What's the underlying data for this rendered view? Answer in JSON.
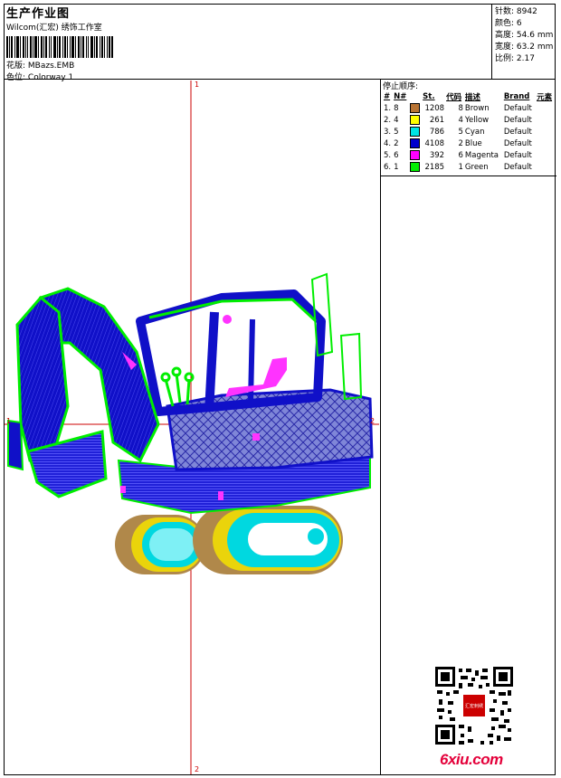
{
  "header": {
    "title": "生产作业图",
    "studio": "Wilcom(汇宏) 绣饰工作室",
    "design_label": "花版:",
    "design_value": "MBazs.EMB",
    "colorway_label": "色位:",
    "colorway_value": "Colorway 1"
  },
  "stats": [
    {
      "label": "针数:",
      "value": "8942"
    },
    {
      "label": "颜色:",
      "value": "6"
    },
    {
      "label": "高度:",
      "value": "54.6 mm"
    },
    {
      "label": "宽度:",
      "value": "63.2 mm"
    },
    {
      "label": "比例:",
      "value": "2.17"
    }
  ],
  "stop_sequence": {
    "title": "停止顺序:",
    "headers": [
      "#",
      "N#",
      "St.",
      "代码",
      "描述",
      "Brand",
      "元素"
    ],
    "rows": [
      {
        "idx": "1.",
        "n": "8",
        "color": "#b87333",
        "st": "1208",
        "code": "8",
        "desc": "Brown",
        "brand": "Default"
      },
      {
        "idx": "2.",
        "n": "4",
        "color": "#ffff00",
        "st": "261",
        "code": "4",
        "desc": "Yellow",
        "brand": "Default"
      },
      {
        "idx": "3.",
        "n": "5",
        "color": "#00e5e5",
        "st": "786",
        "code": "5",
        "desc": "Cyan",
        "brand": "Default"
      },
      {
        "idx": "4.",
        "n": "2",
        "color": "#0000cc",
        "st": "4108",
        "code": "2",
        "desc": "Blue",
        "brand": "Default"
      },
      {
        "idx": "5.",
        "n": "6",
        "color": "#ff00ff",
        "st": "392",
        "code": "6",
        "desc": "Magenta",
        "brand": "Default"
      },
      {
        "idx": "6.",
        "n": "1",
        "color": "#00ee00",
        "st": "2185",
        "code": "1",
        "desc": "Green",
        "brand": "Default"
      }
    ]
  },
  "canvas": {
    "guide_top": "1",
    "guide_bottom": "2",
    "guide_left": "1",
    "guide_right": "2",
    "guide_color": "#cc0000"
  },
  "watermark": {
    "text": "6xiu.com",
    "seal_text": "汇宏刺绣"
  }
}
